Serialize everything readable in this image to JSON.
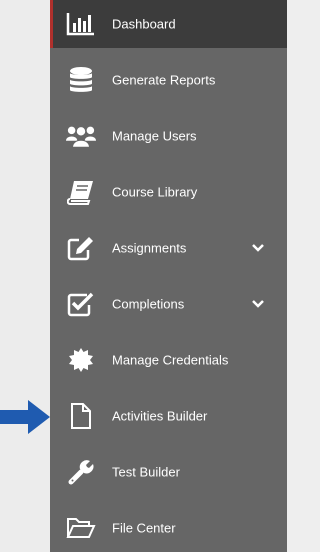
{
  "sidebar": {
    "accent_color": "#b0302c",
    "background_color": "#666666",
    "items": [
      {
        "label": "Dashboard",
        "icon": "bar-chart-icon",
        "active": true
      },
      {
        "label": "Generate Reports",
        "icon": "database-icon"
      },
      {
        "label": "Manage Users",
        "icon": "users-icon"
      },
      {
        "label": "Course Library",
        "icon": "book-icon"
      },
      {
        "label": "Assignments",
        "icon": "edit-icon",
        "expandable": true
      },
      {
        "label": "Completions",
        "icon": "check-square-icon",
        "expandable": true
      },
      {
        "label": "Manage Credentials",
        "icon": "certificate-icon"
      },
      {
        "label": "Activities Builder",
        "icon": "file-icon"
      },
      {
        "label": "Test Builder",
        "icon": "wrench-icon"
      },
      {
        "label": "File Center",
        "icon": "folder-open-icon"
      }
    ]
  },
  "pointer_arrow": {
    "icon": "arrow-right-icon",
    "color": "#1f5bb0"
  }
}
